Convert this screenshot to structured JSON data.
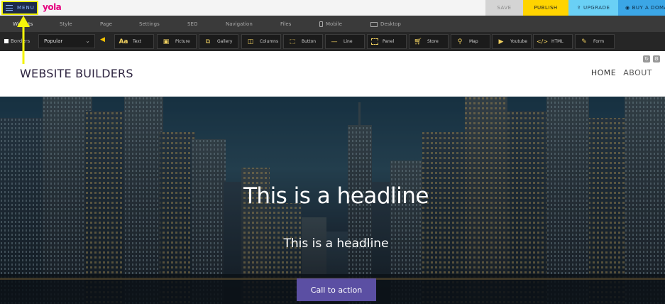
{
  "topbar": {
    "menu_label": "MENU",
    "logo": "yola",
    "save_label": "SAVE",
    "publish_label": "PUBLISH",
    "upgrade_label": "UPGRADE",
    "domain_label": "BUY A DOMA"
  },
  "nav_tabs": [
    "Widgets",
    "Style",
    "Page",
    "Settings",
    "SEO",
    "Navigation",
    "Files",
    "Mobile",
    "Desktop"
  ],
  "widget_bar": {
    "borders_label": "Borders",
    "category_select": "Popular",
    "widgets": [
      {
        "label": "Text",
        "icon": "text-icon"
      },
      {
        "label": "Picture",
        "icon": "picture-icon"
      },
      {
        "label": "Gallery",
        "icon": "gallery-icon"
      },
      {
        "label": "Columns",
        "icon": "columns-icon"
      },
      {
        "label": "Button",
        "icon": "button-icon"
      },
      {
        "label": "Line",
        "icon": "line-icon"
      },
      {
        "label": "Panel",
        "icon": "panel-icon"
      },
      {
        "label": "Store",
        "icon": "store-icon"
      },
      {
        "label": "Map",
        "icon": "map-pin-icon"
      },
      {
        "label": "Youtube",
        "icon": "youtube-icon"
      },
      {
        "label": "HTML",
        "icon": "code-icon"
      },
      {
        "label": "Form",
        "icon": "form-icon"
      }
    ]
  },
  "site": {
    "title": "WEBSITE BUILDERS",
    "nav": [
      "HOME",
      "ABOUT"
    ]
  },
  "hero": {
    "headline": "This is a headline",
    "subheadline": "This is a headline",
    "cta_label": "Call to action"
  },
  "colors": {
    "accent_yellow": "#f4f40a",
    "publish": "#ffd400",
    "upgrade": "#6ad0f5",
    "cta": "#5b4fa3",
    "logo": "#e5007e"
  }
}
